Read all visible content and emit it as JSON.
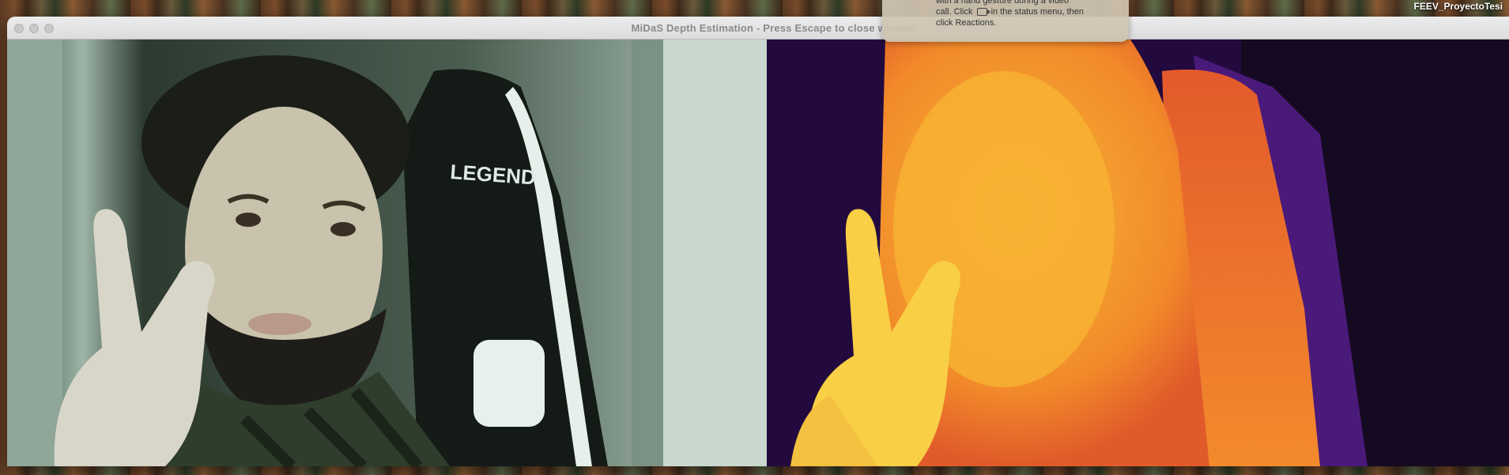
{
  "window": {
    "title": "MiDaS Depth Estimation - Press Escape to close window"
  },
  "webcam": {
    "chair_brand": "LEGEND"
  },
  "notification": {
    "line1": "with a hand gesture during a video",
    "line2_before": "call. Click",
    "line2_after": "in the status menu, then",
    "line3": "click Reactions."
  },
  "menubar": {
    "user": "FEEV_ProyectoTesi"
  },
  "colors": {
    "depth_far": "#200838",
    "depth_mid": "#e8552a",
    "depth_near": "#f9d94a"
  }
}
